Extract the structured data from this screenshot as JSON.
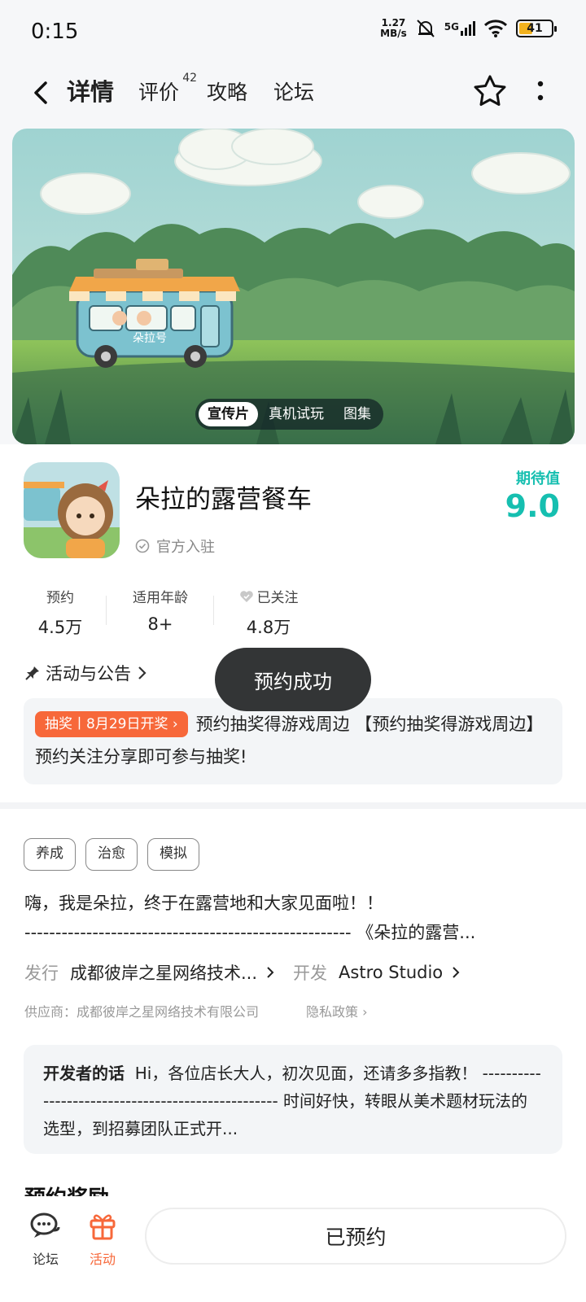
{
  "status_bar": {
    "time": "0:15",
    "net_speed_value": "1.27",
    "net_speed_unit": "MB/s",
    "signal": "5G",
    "battery": "41"
  },
  "nav": {
    "tabs": [
      {
        "label": "详情",
        "active": true
      },
      {
        "label": "评价",
        "badge": "42"
      },
      {
        "label": "攻略"
      },
      {
        "label": "论坛"
      }
    ]
  },
  "banner": {
    "bus_text": "朵拉号",
    "media_tabs": [
      "宣传片",
      "真机试玩",
      "图集"
    ]
  },
  "app": {
    "title": "朵拉的露营餐车",
    "official": "官方入驻",
    "expect_label": "期待值",
    "expect_value": "9.0"
  },
  "stats": [
    {
      "label": "预约",
      "value": "4.5万"
    },
    {
      "label": "适用年龄",
      "value": "8+"
    },
    {
      "label": "已关注",
      "value": "4.8万"
    }
  ],
  "activity": {
    "header": "活动与公告",
    "badge": "抽奖丨8月29日开奖",
    "text": "预约抽奖得游戏周边 【预约抽奖得游戏周边】预约关注分享即可参与抽奖!"
  },
  "toast": "预约成功",
  "tags": [
    "养成",
    "治愈",
    "模拟"
  ],
  "description": {
    "line1": "嗨，我是朵拉，终于在露营地和大家见面啦！！",
    "line2": "----------------------------------------------------- 《朵拉的露营..."
  },
  "meta": {
    "publisher_key": "发行",
    "publisher_val": "成都彼岸之星网络技术...",
    "developer_key": "开发",
    "developer_val": "Astro Studio",
    "supplier": "供应商：成都彼岸之星网络技术有限公司",
    "privacy": "隐私政策"
  },
  "dev_words": {
    "title": "开发者的话",
    "text": "Hi，各位店长大人，初次见面，还请多多指教！ -------------------------------------------------- 时间好快，转眼从美术题材玩法的选型，到招募团队正式开..."
  },
  "next_section": "预约奖励",
  "bottom": {
    "forum": "论坛",
    "activity": "活动",
    "reserve": "已预约"
  },
  "colors": {
    "accent": "#22cfc0",
    "expect": "#16bfb0",
    "lottery": "#f7683a",
    "activity_tab": "#f7683a"
  }
}
